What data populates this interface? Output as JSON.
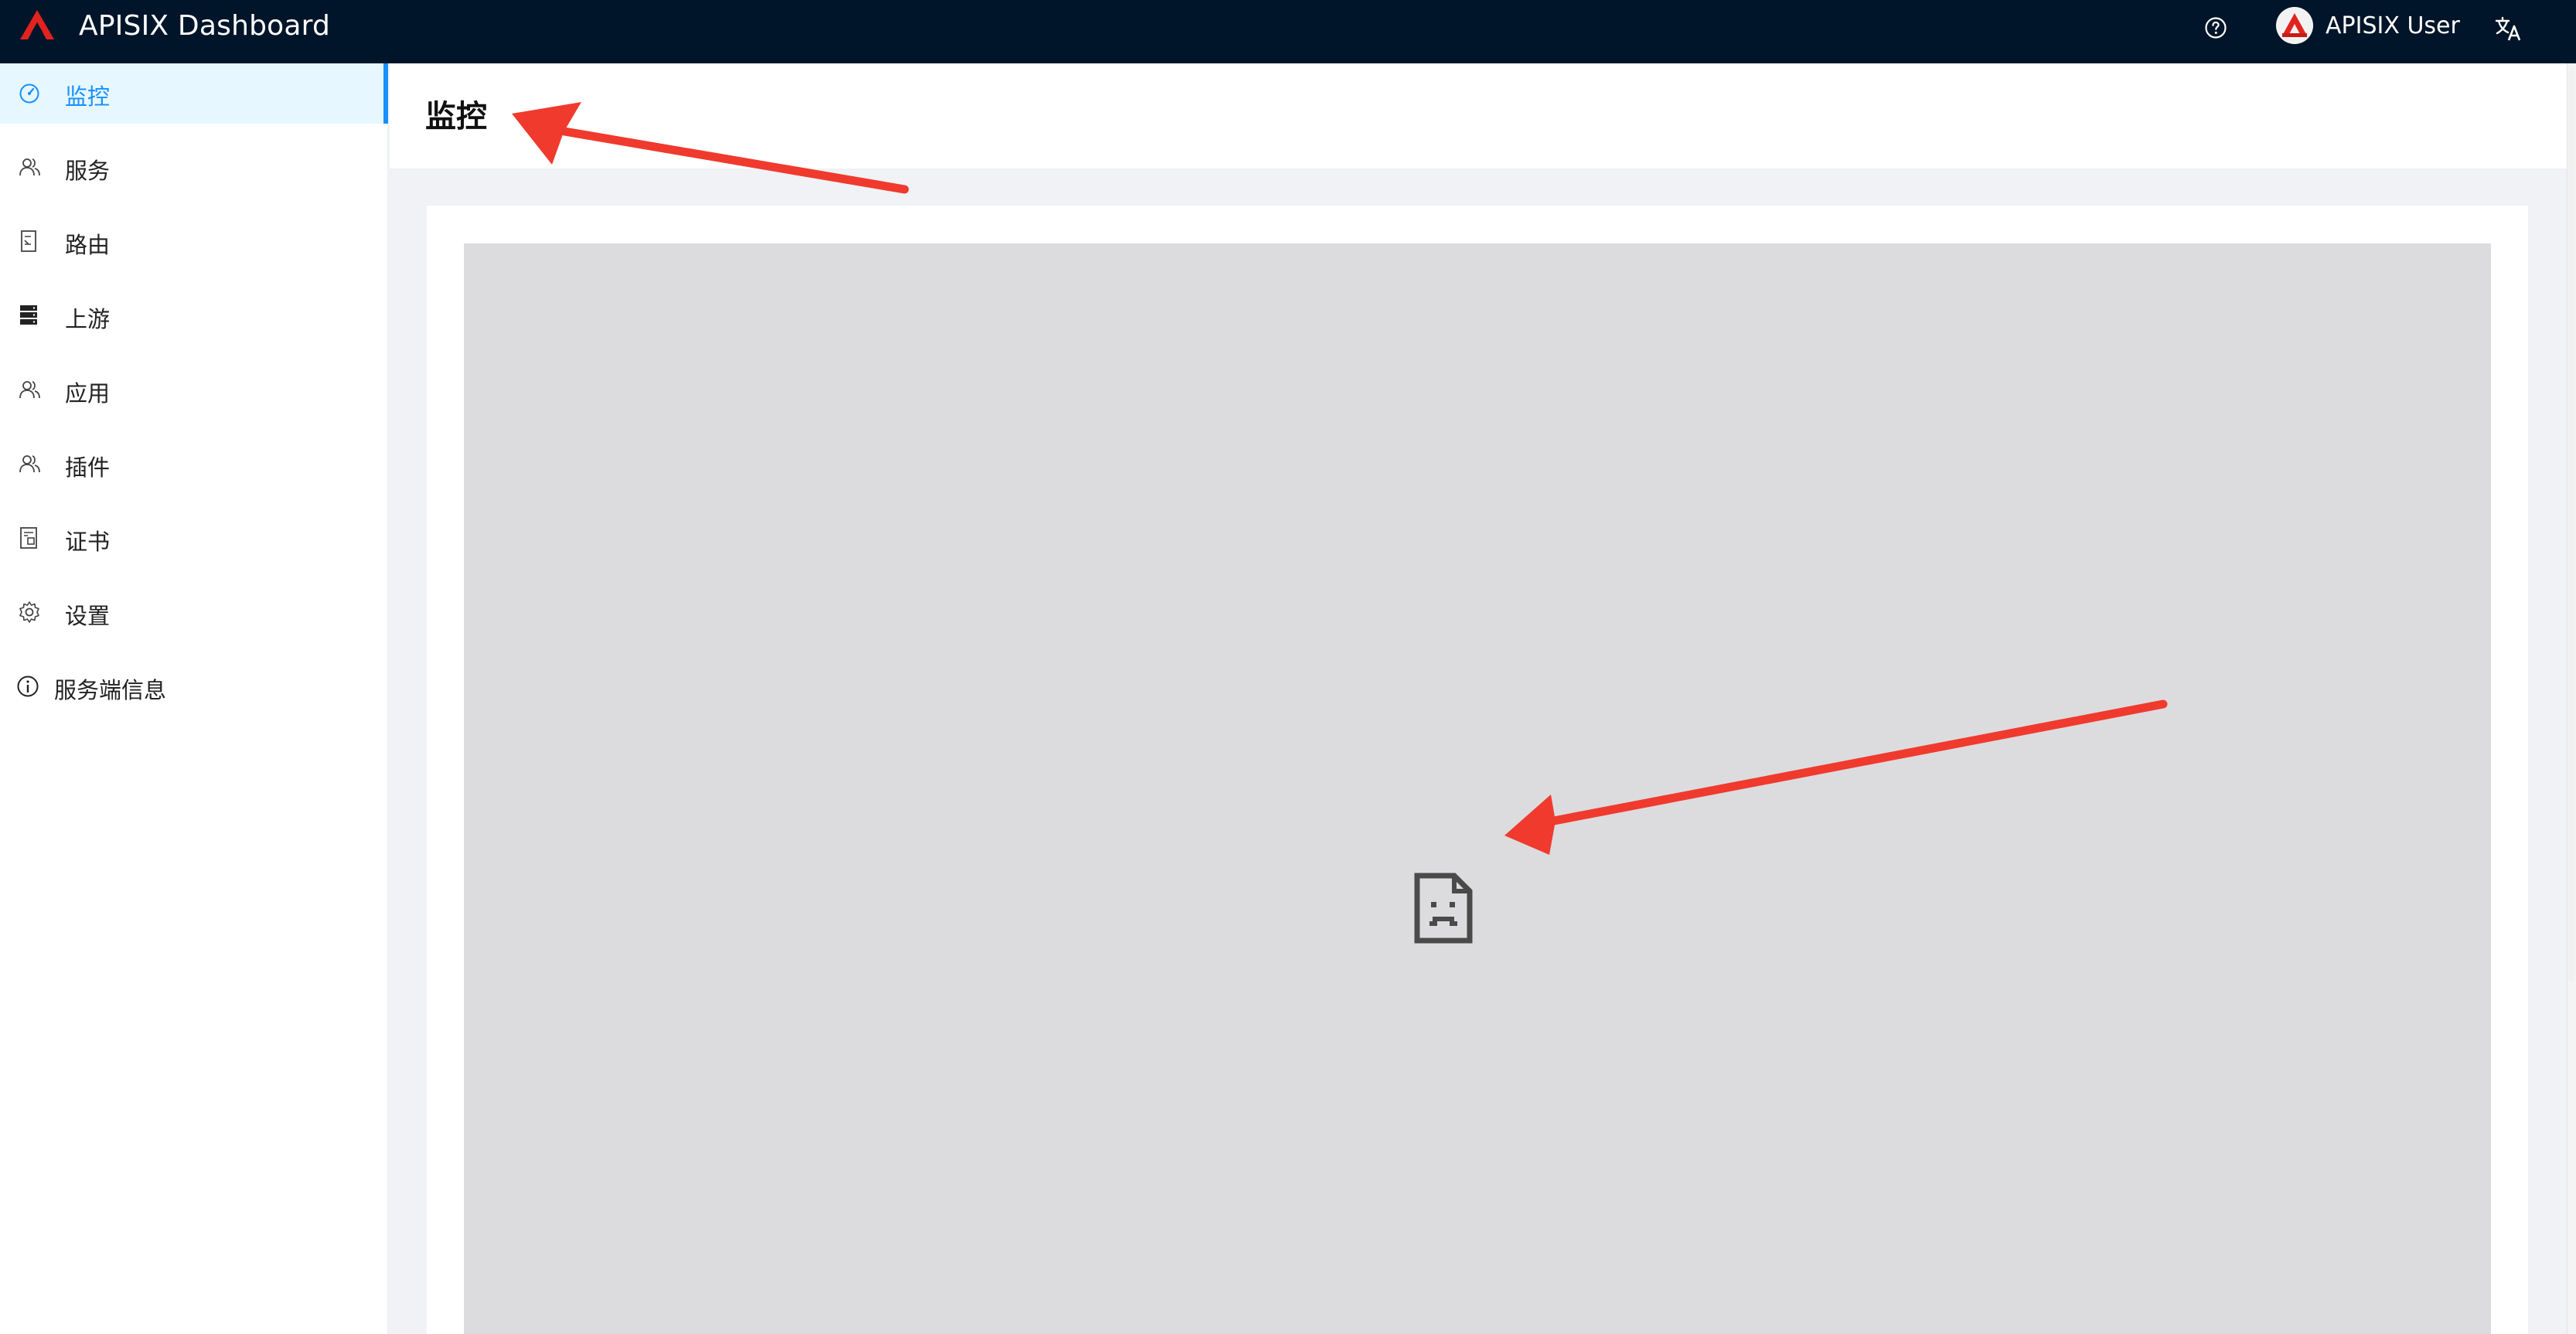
{
  "app": {
    "title": "APISIX Dashboard",
    "brand_color": "#e1231f",
    "header_bg": "#001529"
  },
  "header": {
    "help_icon": "question-circle-icon",
    "user": {
      "name": "APISIX User",
      "avatar_icon": "apisix-avatar"
    },
    "language_icon": "translate-icon"
  },
  "sidebar": {
    "items": [
      {
        "label": "监控",
        "icon": "dashboard-icon",
        "active": true
      },
      {
        "label": "服务",
        "icon": "user-group-icon"
      },
      {
        "label": "路由",
        "icon": "route-doc-icon"
      },
      {
        "label": "上游",
        "icon": "server-stack-icon"
      },
      {
        "label": "应用",
        "icon": "user-group-icon"
      },
      {
        "label": "插件",
        "icon": "user-group-icon"
      },
      {
        "label": "证书",
        "icon": "certificate-icon"
      },
      {
        "label": "设置",
        "icon": "gear-icon"
      },
      {
        "label": "服务端信息",
        "icon": "info-circle-icon"
      }
    ],
    "active_color": "#1890ff",
    "active_bg": "#e6f7ff"
  },
  "page": {
    "title": "监控"
  },
  "content": {
    "embedded_frame_state": "failed-to-load",
    "broken_icon": "broken-document-icon"
  },
  "annotation": {
    "arrow_color": "#f03a2e"
  }
}
